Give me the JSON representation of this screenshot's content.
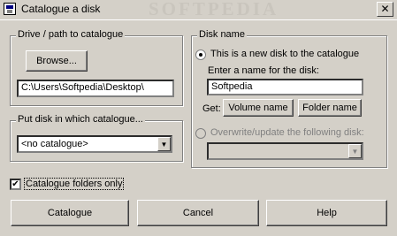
{
  "window": {
    "title": "Catalogue a disk",
    "watermark": "SOFTPEDIA",
    "close_glyph": "✕"
  },
  "drive_group": {
    "label": "Drive / path to catalogue",
    "browse_button": "Browse...",
    "path_value": "C:\\Users\\Softpedia\\Desktop\\"
  },
  "catalogue_group": {
    "label": "Put disk in which catalogue...",
    "selected": "<no catalogue>"
  },
  "disk_name_group": {
    "label": "Disk name",
    "new_disk_option": "This is a new disk to the catalogue",
    "new_disk_checked": true,
    "enter_name_label": "Enter a name for the disk:",
    "name_value": "Softpedia",
    "get_label": "Get:",
    "volume_name_button": "Volume name",
    "folder_name_button": "Folder name",
    "overwrite_option": "Overwrite/update the following disk:",
    "overwrite_checked": false,
    "overwrite_selected": ""
  },
  "options": {
    "catalogue_folders_only": "Catalogue folders only",
    "catalogue_folders_only_checked": true
  },
  "buttons": {
    "catalogue": "Catalogue",
    "cancel": "Cancel",
    "help": "Help"
  },
  "icons": {
    "check_glyph": "✔",
    "dropdown_glyph": "▼"
  }
}
